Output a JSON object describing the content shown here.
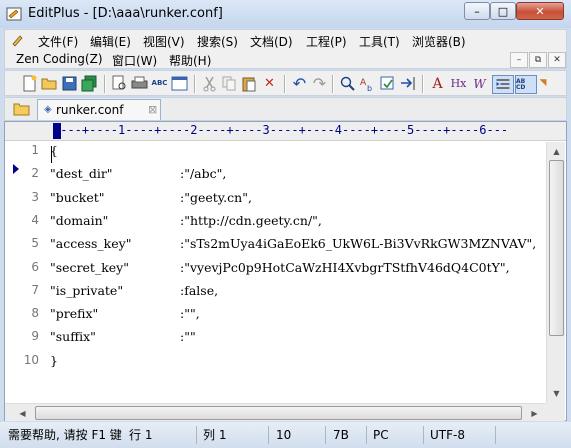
{
  "window": {
    "app_name": "EditPlus",
    "title": "EditPlus - [D:\\aaa\\runker.conf]",
    "controls": {
      "minimize": "–",
      "maximize": "□",
      "close": "✕"
    }
  },
  "menu": {
    "row1": [
      "文件(F)",
      "编辑(E)",
      "视图(V)",
      "搜索(S)",
      "文档(D)",
      "工程(P)",
      "工具(T)",
      "浏览器(B)"
    ],
    "row2": [
      "Zen Coding(Z)",
      "窗口(W)",
      "帮助(H)"
    ],
    "mdi_controls": {
      "minimize": "–",
      "restore": "⧉",
      "close": "✕"
    }
  },
  "toolbar": {
    "icons": [
      "new-file-icon",
      "open-icon",
      "save-icon",
      "save-all-icon",
      "print-preview-icon",
      "print-icon",
      "spell-check-icon",
      "browser-icon",
      "cut-icon",
      "copy-icon",
      "paste-icon",
      "delete-icon",
      "undo-icon",
      "redo-icon",
      "find-icon",
      "replace-icon",
      "find-in-files-icon",
      "goto-icon",
      "font-icon",
      "hex-icon",
      "word-wrap-icon",
      "indent-icon",
      "abc-icon"
    ],
    "labels": {
      "spell": "ABC",
      "hex": "Hx",
      "wrap": "W",
      "font": "A",
      "abc": "AB CD"
    }
  },
  "tabs": [
    {
      "label": "runker.conf",
      "icon": "file-icon",
      "close": "⊠",
      "active": true
    }
  ],
  "editor": {
    "ruler": "----+----1----+----2----+----3----+----4----+----5----+----6---",
    "lines": [
      {
        "no": "1",
        "key": "{",
        "value": ""
      },
      {
        "no": "2",
        "key": "\"dest_dir\"",
        "value": ":\"/abc\","
      },
      {
        "no": "3",
        "key": "\"bucket\"",
        "value": ":\"geety.cn\","
      },
      {
        "no": "4",
        "key": "\"domain\"",
        "value": ":\"http://cdn.geety.cn/\","
      },
      {
        "no": "5",
        "key": "\"access_key\"",
        "value": ":\"sTs2mUya4iGaEoEk6_UkW6L-Bi3VvRkGW3MZNVAV\","
      },
      {
        "no": "6",
        "key": "\"secret_key\"",
        "value": ":\"vyevjPc0p9HotCaWzHI4XvbgrTStfhV46dQ4C0tY\","
      },
      {
        "no": "7",
        "key": "\"is_private\"",
        "value": ":false,"
      },
      {
        "no": "8",
        "key": "\"prefix\"",
        "value": ":\"\","
      },
      {
        "no": "9",
        "key": "\"suffix\"",
        "value": ":\"\""
      },
      {
        "no": "10",
        "key": "}",
        "value": ""
      }
    ]
  },
  "scrollbars": {
    "up": "▲",
    "down": "▼",
    "left": "◀",
    "right": "▶"
  },
  "status": {
    "help": "需要帮助, 请按 F1 键",
    "line": "行 1",
    "col": "列 1",
    "total": "10",
    "size": "7B",
    "eol": "PC",
    "encoding": "UTF-8"
  }
}
